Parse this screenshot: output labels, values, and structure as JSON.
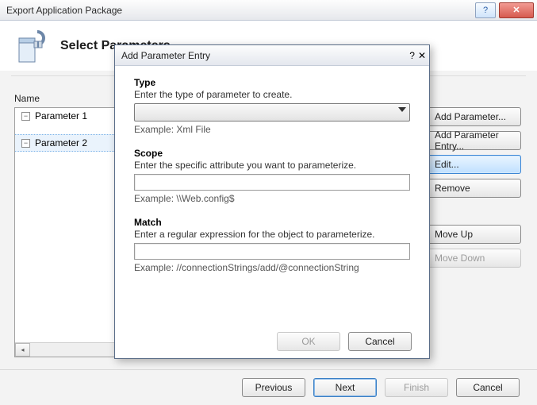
{
  "window": {
    "title": "Export Application Package",
    "header": "Select Parameters"
  },
  "tree": {
    "label": "Name",
    "items": [
      {
        "label": "Parameter 1"
      },
      {
        "label": "Parameter 2"
      }
    ]
  },
  "side": {
    "add_parameter": "Add Parameter...",
    "add_entry": "Add Parameter Entry...",
    "edit": "Edit...",
    "remove": "Remove",
    "move_up": "Move Up",
    "move_down": "Move Down"
  },
  "footer": {
    "previous": "Previous",
    "next": "Next",
    "finish": "Finish",
    "cancel": "Cancel"
  },
  "dialog": {
    "title": "Add Parameter Entry",
    "type": {
      "label": "Type",
      "desc": "Enter the type of parameter to create.",
      "example": "Example: Xml File"
    },
    "scope": {
      "label": "Scope",
      "desc": "Enter the specific attribute you want to parameterize.",
      "value": "",
      "example": "Example: \\\\Web.config$"
    },
    "match": {
      "label": "Match",
      "desc": "Enter a regular expression for the object to parameterize.",
      "value": "",
      "example": "Example: //connectionStrings/add/@connectionString"
    },
    "ok": "OK",
    "cancel": "Cancel"
  },
  "glyphs": {
    "help": "?",
    "close": "✕",
    "minus": "−",
    "left": "◂",
    "right": "▸"
  }
}
